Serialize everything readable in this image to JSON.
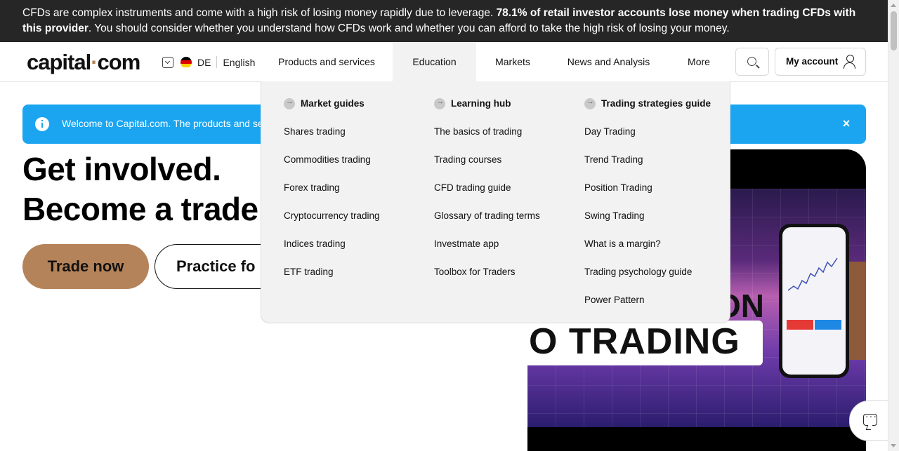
{
  "risk_warning": {
    "part1": "CFDs are complex instruments and come with a high risk of losing money rapidly due to leverage. ",
    "bold": "78.1% of retail investor accounts lose money when trading CFDs with this provider",
    "part2": ". You should consider whether you understand how CFDs work and whether you can afford to take the high risk of losing your money."
  },
  "header": {
    "logo_left": "capital",
    "logo_dot": "·",
    "logo_right": "com",
    "country_code": "DE",
    "language": "English",
    "nav": [
      "Products and services",
      "Education",
      "Markets",
      "News and Analysis",
      "More"
    ],
    "account_label": "My account"
  },
  "notice": {
    "message": "Welcome to Capital.com. The products and serv",
    "close": "×"
  },
  "hero": {
    "title_line1": "Get involved.",
    "title_line2": "Become a trade",
    "trade_button": "Trade now",
    "practice_button": "Practice fo",
    "image_text": "O TRADING",
    "image_text_partial": "ON"
  },
  "dropdown": {
    "columns": [
      {
        "heading": "Market guides",
        "links": [
          "Shares trading",
          "Commodities trading",
          "Forex trading",
          "Cryptocurrency trading",
          "Indices trading",
          "ETF trading"
        ]
      },
      {
        "heading": "Learning hub",
        "links": [
          "The basics of trading",
          "Trading courses",
          "CFD trading guide",
          "Glossary of trading terms",
          "Investmate app",
          "Toolbox for Traders"
        ]
      },
      {
        "heading": "Trading strategies guide",
        "links": [
          "Day Trading",
          "Trend Trading",
          "Position Trading",
          "Swing Trading",
          "What is a margin?",
          "Trading psychology guide",
          "Power Pattern"
        ]
      }
    ]
  },
  "colors": {
    "brand_accent": "#b58359",
    "notice_blue": "#1ba5f1",
    "banner_dark": "#262626"
  }
}
